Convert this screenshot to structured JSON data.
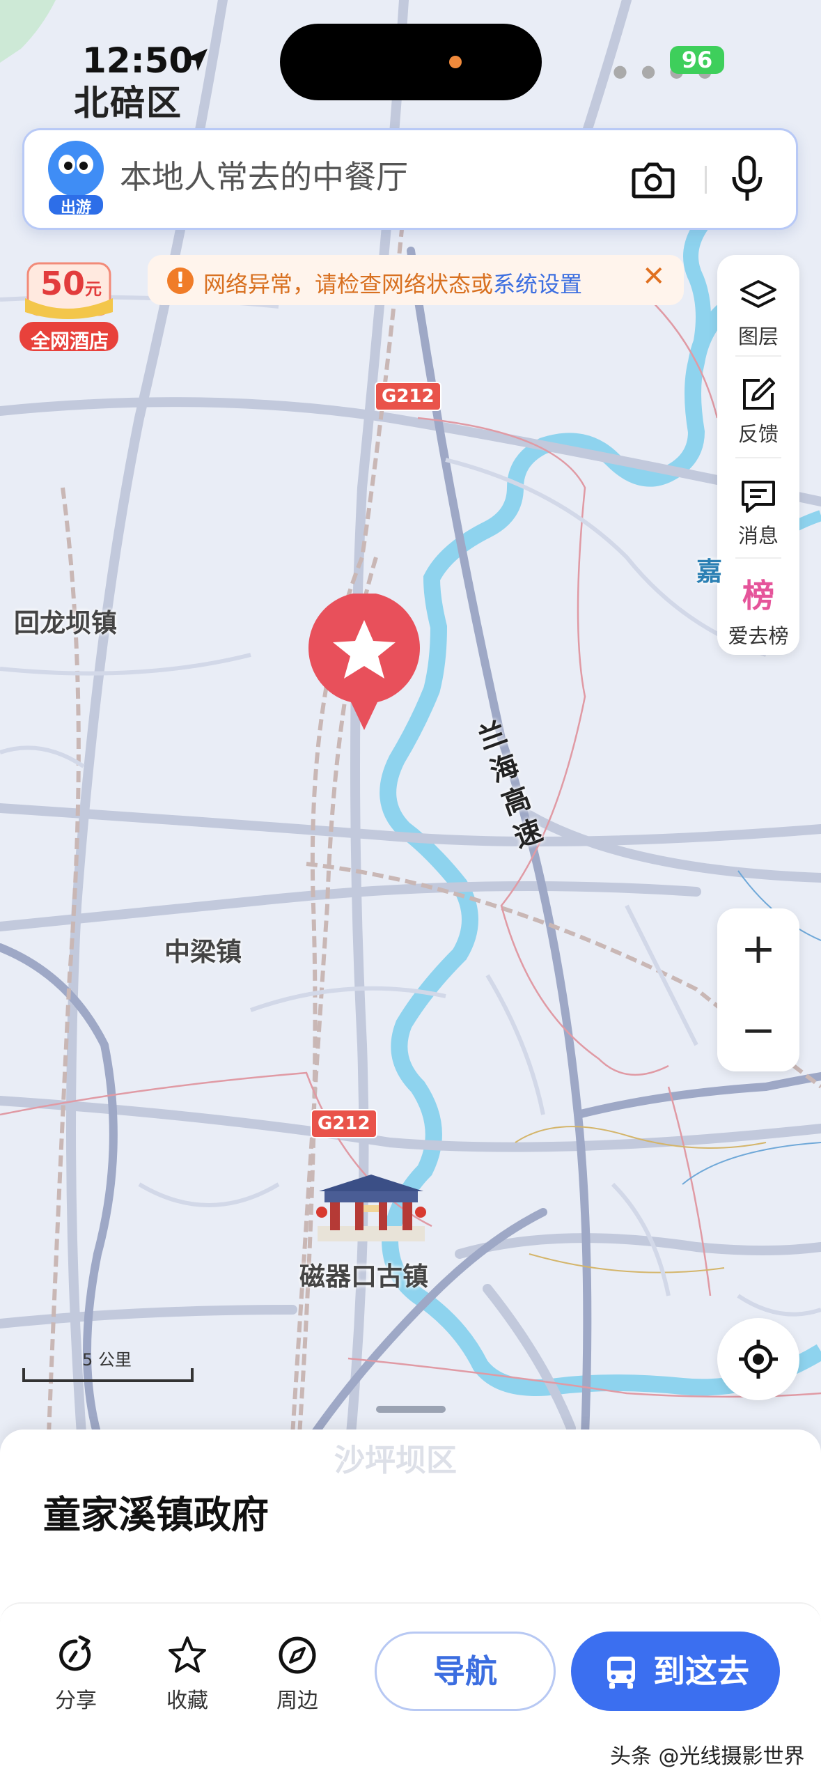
{
  "status_bar": {
    "time": "12:50",
    "battery": "96"
  },
  "map": {
    "district": "北碚区",
    "labels": {
      "huilongba": "回龙坝镇",
      "zhongliang": "中梁镇",
      "ciqikou": "磁器口古镇",
      "shapingba": "沙坪坝区",
      "jia": "嘉",
      "lanhai": "兰海高速",
      "g212_top": "G212",
      "g212_bottom": "G212"
    },
    "scale_label": "5 公里"
  },
  "search": {
    "badge": "出游",
    "placeholder": "本地人常去的中餐厅"
  },
  "notice": {
    "text": "网络异常，请检查网络状态或",
    "link": "系统设置"
  },
  "hotel_badge": {
    "amount": "50",
    "unit": "元",
    "label": "全网酒店"
  },
  "toolbar": {
    "layers": "图层",
    "feedback": "反馈",
    "messages": "消息",
    "ranking": "爱去榜",
    "ranking_glyph": "榜"
  },
  "zoom": {
    "in": "+",
    "out": "−"
  },
  "place": {
    "title": "童家溪镇政府"
  },
  "actions": {
    "share": "分享",
    "favorite": "收藏",
    "nearby": "周边",
    "navigate": "导航",
    "go": "到这去"
  },
  "watermark": "头条 @光线摄影世界",
  "colors": {
    "accent": "#3b6ff0",
    "marker": "#e8505b",
    "river": "#8ed3ee",
    "warning": "#f07c28"
  }
}
